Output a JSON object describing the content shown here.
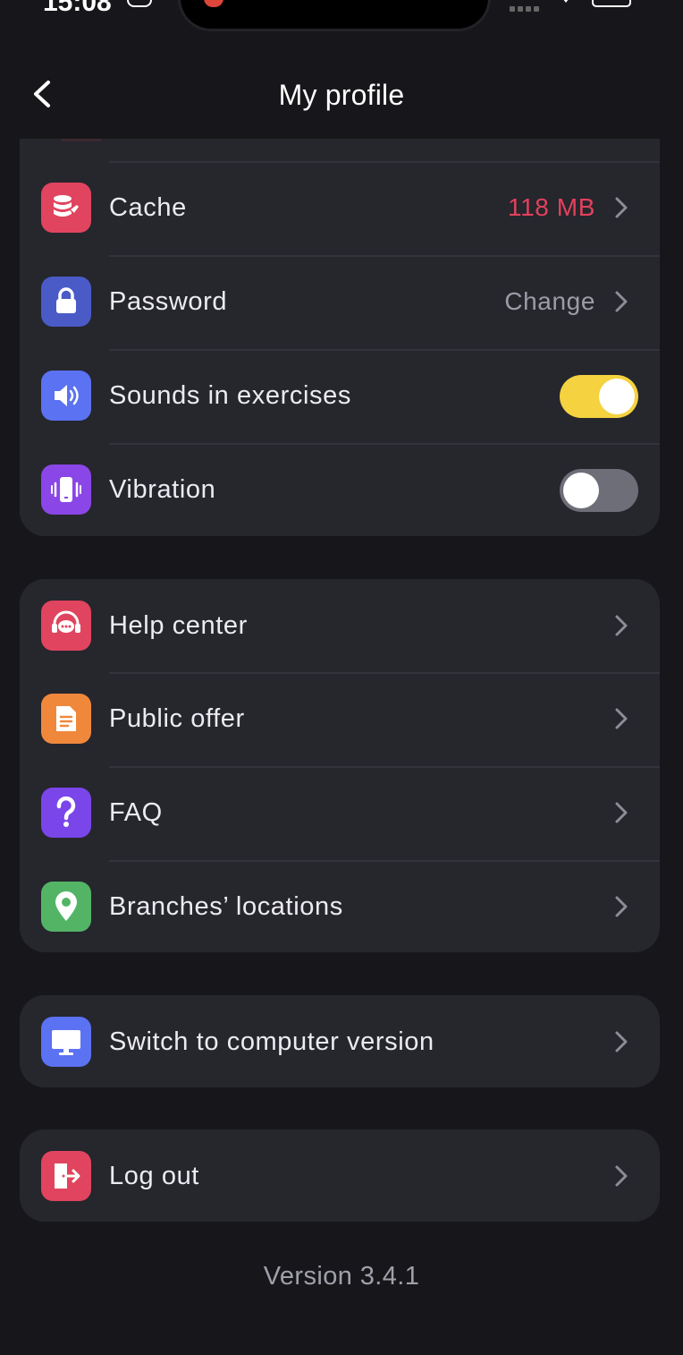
{
  "status_bar": {
    "time": "15:08"
  },
  "header": {
    "title": "My profile"
  },
  "settings": {
    "cache": {
      "label": "Cache",
      "value": "118 MB",
      "value_color": "#e2415c",
      "icon": "database-broom-icon",
      "icon_color": "#e0445e"
    },
    "password": {
      "label": "Password",
      "value": "Change",
      "icon": "lock-icon",
      "icon_color": "#4a5bc7"
    },
    "sounds": {
      "label": "Sounds in exercises",
      "enabled": true,
      "icon": "speaker-icon",
      "icon_color": "#5b72f2"
    },
    "vibration": {
      "label": "Vibration",
      "enabled": false,
      "icon": "vibrating-phone-icon",
      "icon_color": "#8a46e6"
    }
  },
  "support": {
    "help_center": {
      "label": "Help center",
      "icon": "headset-chat-icon",
      "icon_color": "#e0445e"
    },
    "public_offer": {
      "label": "Public offer",
      "icon": "document-icon",
      "icon_color": "#f0883c"
    },
    "faq": {
      "label": "FAQ",
      "icon": "question-mark-icon",
      "icon_color": "#7a46ea"
    },
    "branches": {
      "label": "Branches’ locations",
      "icon": "map-pin-icon",
      "icon_color": "#53b466"
    }
  },
  "desktop": {
    "label": "Switch to computer version",
    "icon": "monitor-icon",
    "icon_color": "#5b72f2"
  },
  "logout": {
    "label": "Log out",
    "icon": "logout-door-icon",
    "icon_color": "#e0445e"
  },
  "footer": {
    "version": "Version 3.4.1"
  },
  "colors": {
    "background": "#17171b",
    "card": "#26262d",
    "toggle_on": "#f5d23f",
    "toggle_off": "#6e6e78"
  }
}
